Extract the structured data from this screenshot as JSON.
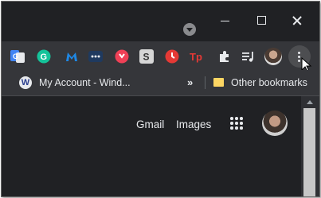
{
  "toolbar": {
    "extensions": [
      {
        "icon": "google-translate-icon",
        "color": "#4285f4"
      },
      {
        "icon": "grammarly-icon",
        "color": "#15c39a"
      },
      {
        "icon": "malwarebytes-icon",
        "color": "#1e88e5"
      },
      {
        "icon": "more-dots-extension-icon",
        "color": "#8ab4f8"
      },
      {
        "icon": "pocket-icon",
        "color": "#ef4056"
      },
      {
        "icon": "s-extension-icon",
        "color": "#e8eaed"
      },
      {
        "icon": "clock-extension-icon",
        "color": "#e53935"
      },
      {
        "icon": "tp-extension-icon",
        "color": "#e53935"
      },
      {
        "icon": "puzzle-extensions-icon",
        "color": "#e8eaed"
      },
      {
        "icon": "media-queue-icon",
        "color": "#e8eaed"
      }
    ]
  },
  "bookmarks": {
    "item_label": "My Account - Wind...",
    "item_icon_letter": "W",
    "overflow_label": "»",
    "other_label": "Other bookmarks"
  },
  "content": {
    "gmail_label": "Gmail",
    "images_label": "Images"
  }
}
